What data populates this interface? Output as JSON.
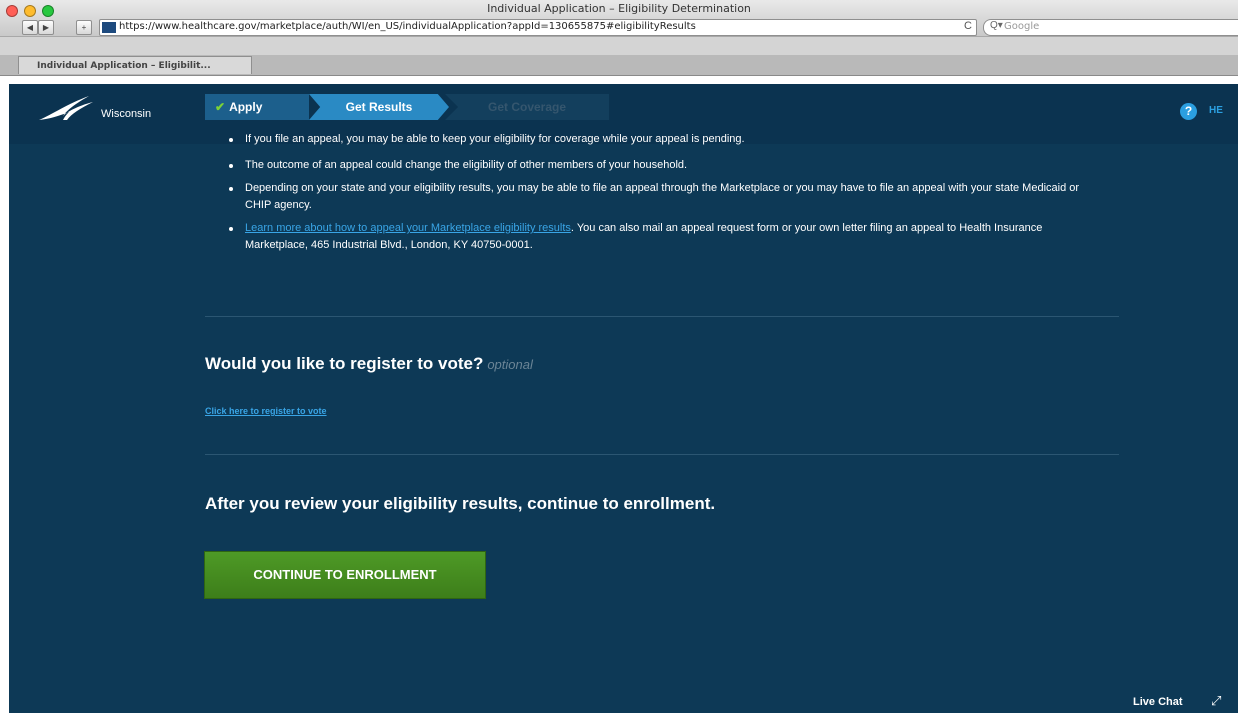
{
  "browser": {
    "window_title": "Individual Application – Eligibility Determination",
    "back_glyph": "◀",
    "forward_glyph": "▶",
    "add_glyph": "+",
    "url": "https://www.healthcare.gov/marketplace/auth/WI/en_US/individualApplication?appId=130655875#eligibilityResults",
    "reload_glyph": "C",
    "search_placeholder": "Google",
    "search_glyph": "Q▾",
    "tab_label": "Individual Application – Eligibilit..."
  },
  "site": {
    "state_name": "Wisconsin",
    "steps": {
      "apply": "Apply",
      "apply_check": "✔",
      "results": "Get Results",
      "coverage": "Get Coverage"
    },
    "help_glyph": "?",
    "help_label": "HE"
  },
  "appeal_bullets": [
    "If you file an appeal, you may be able to keep your eligibility for coverage while your appeal is pending.",
    "The outcome of an appeal could change the eligibility of other members of your household.",
    "Depending on your state and your eligibility results, you may be able to file an appeal through the Marketplace or you may have to file an appeal with your state Medicaid or CHIP agency."
  ],
  "appeal_link": {
    "link_text": "Learn more about how to appeal your Marketplace eligibility results",
    "rest_text": ". You can also mail an appeal request form or your own letter filing an appeal to Health Insurance Marketplace, 465 Industrial Blvd., London, KY 40750-0001."
  },
  "vote": {
    "heading": "Would you like to register to vote?",
    "optional_label": "optional",
    "link": "Click here to register to vote"
  },
  "enrollment": {
    "heading": "After you review your eligibility results, continue to enrollment.",
    "button_label": "CONTINUE TO ENROLLMENT"
  },
  "footer": {
    "live_chat_label": "Live Chat",
    "expand_glyph": "⤢"
  },
  "colors": {
    "page_background": "#0d3956",
    "link": "#39a5e6",
    "button_green": "#4e9a26",
    "active_step": "#2a8ac4"
  }
}
